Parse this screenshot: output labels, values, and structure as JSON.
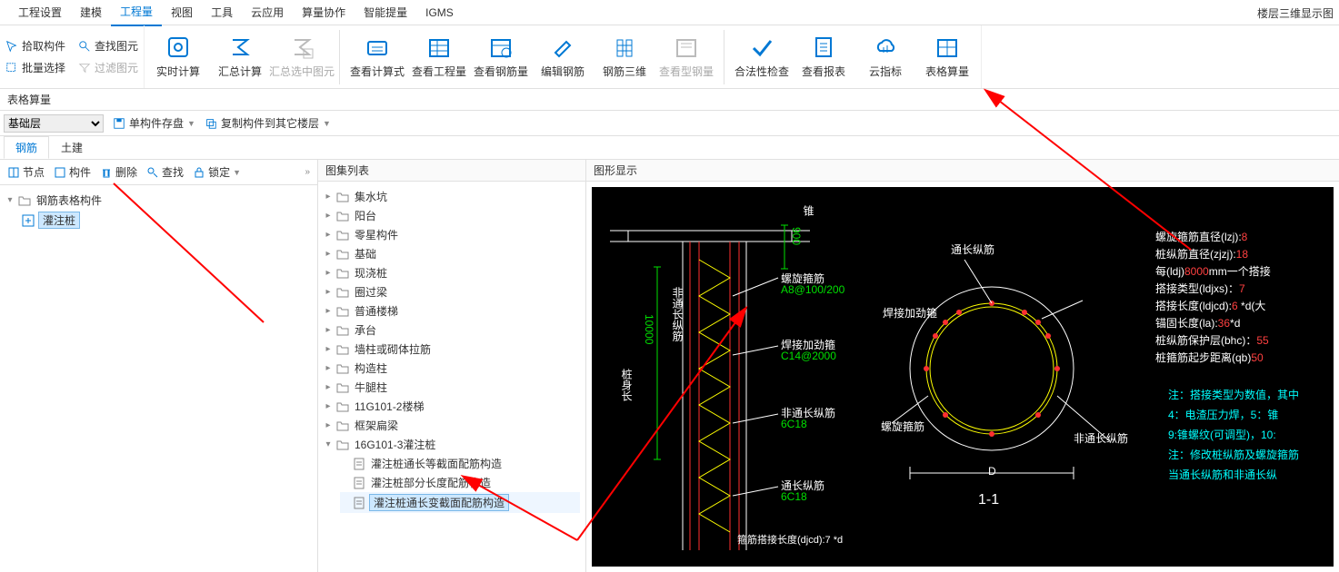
{
  "menubar": {
    "items": [
      "工程设置",
      "建模",
      "工程量",
      "视图",
      "工具",
      "云应用",
      "算量协作",
      "智能提量",
      "IGMS"
    ],
    "active_index": 2,
    "right_title": "楼层三维显示图"
  },
  "ribbon": {
    "small_left": [
      {
        "icon": "pick",
        "label": "拾取构件"
      },
      {
        "icon": "search",
        "label": "查找图元"
      },
      {
        "icon": "batch",
        "label": "批量选择"
      },
      {
        "icon": "filter",
        "label": "过滤图元"
      }
    ],
    "big": [
      {
        "icon": "realtime",
        "label": "实时计算"
      },
      {
        "icon": "sum",
        "label": "汇总计算"
      },
      {
        "icon": "sum-sel",
        "label": "汇总选中图元",
        "disabled": true
      },
      {
        "icon": "formula",
        "label": "查看计算式"
      },
      {
        "icon": "qty",
        "label": "查看工程量"
      },
      {
        "icon": "rebar-qty",
        "label": "查看钢筋量"
      },
      {
        "icon": "rebar-edit",
        "label": "编辑钢筋"
      },
      {
        "icon": "rebar3d",
        "label": "钢筋三维"
      },
      {
        "icon": "shape-rebar",
        "label": "查看型钢量",
        "disabled": true
      },
      {
        "icon": "check",
        "label": "合法性检查"
      },
      {
        "icon": "report",
        "label": "查看报表"
      },
      {
        "icon": "cloud",
        "label": "云指标"
      },
      {
        "icon": "table",
        "label": "表格算量"
      }
    ]
  },
  "subbar1": {
    "title": "表格算量"
  },
  "subbar2": {
    "floor_select": "基础层",
    "btn1": "单构件存盘",
    "btn2": "复制构件到其它楼层"
  },
  "tabs": {
    "items": [
      "钢筋",
      "土建"
    ],
    "active_index": 0
  },
  "left_panel": {
    "toolbar": [
      "节点",
      "构件",
      "删除",
      "查找",
      "锁定"
    ],
    "tree": {
      "root": "钢筋表格构件",
      "children": [
        {
          "label": "灌注桩",
          "selected": true
        }
      ]
    }
  },
  "mid_panel": {
    "title": "图集列表",
    "tree": [
      {
        "label": "集水坑"
      },
      {
        "label": "阳台"
      },
      {
        "label": "零星构件"
      },
      {
        "label": "基础"
      },
      {
        "label": "现浇桩"
      },
      {
        "label": "圈过梁"
      },
      {
        "label": "普通楼梯"
      },
      {
        "label": "承台"
      },
      {
        "label": "墙柱或砌体拉筋"
      },
      {
        "label": "构造柱"
      },
      {
        "label": "牛腿柱"
      },
      {
        "label": "11G101-2楼梯"
      },
      {
        "label": "框架扁梁"
      },
      {
        "label": "16G101-3灌注桩",
        "expanded": true,
        "children": [
          {
            "label": "灌注桩通长等截面配筋构造"
          },
          {
            "label": "灌注桩部分长度配筋构造"
          },
          {
            "label": "灌注桩通长变截面配筋构造",
            "selected": true
          }
        ]
      }
    ]
  },
  "right_panel": {
    "title": "图形显示",
    "labels": {
      "spiral_stirrup": "螺旋箍筋",
      "spiral_spec": "A8@100/200",
      "weld_stirrup": "焊接加劲箍",
      "weld_spec": "C14@2000",
      "non_through": "非通长纵筋",
      "non_through_spec": "6C18",
      "through": "通长纵筋",
      "through_spec": "6C18",
      "dim_10000": "10000",
      "dim_900": "900",
      "label_taper": "锥",
      "label_body": "桩身长",
      "label_nontrough_v": "非通长纵筋",
      "section_through": "通长纵筋",
      "section_weld": "焊接加劲箍",
      "section_spiral": "螺旋箍筋",
      "section_nonthrough": "非通长纵筋",
      "section_D": "D",
      "section_title": "1-1",
      "stirrup_overlap": "箍筋搭接长度(djcd):7 *d"
    },
    "params": [
      {
        "k": "螺旋箍筋直径(lzj):",
        "v": "8",
        "c": "red"
      },
      {
        "k": "桩纵筋直径(zjzj):",
        "v": "18",
        "c": "red"
      },
      {
        "k": "每(ldj)",
        "mid": "8000",
        "end": "mm一个搭接"
      },
      {
        "k": "搭接类型(ldjxs)：",
        "v": "7",
        "c": "red"
      },
      {
        "k": "搭接长度(ldjcd):",
        "v": "6",
        "end": " *d(大",
        "c": "red"
      },
      {
        "k": "锚固长度(la):",
        "v": "36",
        "end": "*d",
        "c": "red"
      },
      {
        "k": "桩纵筋保护层(bhc)：",
        "v": "55",
        "c": "red"
      },
      {
        "k": "桩箍筋起步距离(qb)",
        "v": "50",
        "c": "red"
      }
    ],
    "notes": [
      "注：搭接类型为数值，其中",
      "4：电渣压力焊，5：锥",
      "9:锥螺纹(可调型)，10:",
      "注：修改桩纵筋及螺旋箍筋",
      "当通长纵筋和非通长纵"
    ]
  }
}
